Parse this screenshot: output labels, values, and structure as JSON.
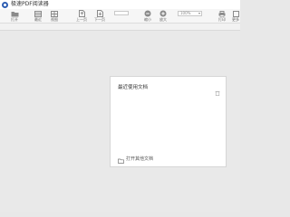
{
  "window": {
    "title": "极速PDF阅读器"
  },
  "toolbar": {
    "open_label": "打开",
    "recent_label": "最近",
    "view_label": "视图",
    "prev_page_label": "上一页",
    "next_page_label": "下一页",
    "page_input_value": "",
    "zoom_out_label": "缩小",
    "zoom_in_label": "放大",
    "zoom_value": "100%",
    "print_label": "打印",
    "more_label": "更多"
  },
  "recent_panel": {
    "title": "最近使用文档",
    "open_other_label": "打开其他文档"
  },
  "colors": {
    "brand": "#2f5fb3",
    "canvas": "#e9e9e9",
    "toolbar": "#f6f6f6"
  },
  "icons": [
    "app-logo",
    "folder-icon",
    "list-icon",
    "grid-icon",
    "prev-page-icon",
    "next-page-icon",
    "zoom-out-icon",
    "zoom-in-icon",
    "printer-icon",
    "back-arrow-icon",
    "trash-icon"
  ]
}
